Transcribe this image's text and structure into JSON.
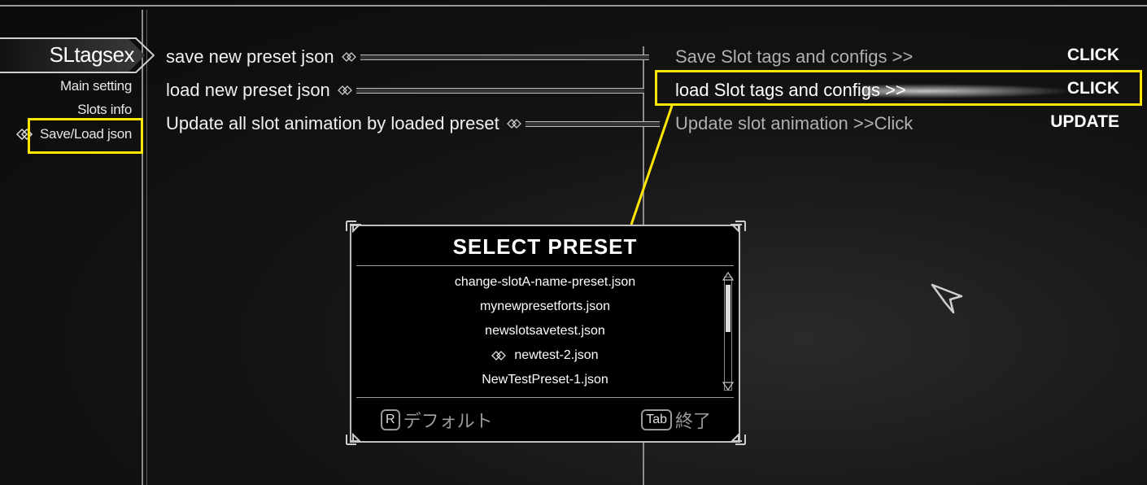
{
  "nav": {
    "title": "SLtagsex",
    "items": [
      {
        "label": "Main setting"
      },
      {
        "label": "Slots info"
      },
      {
        "label": "Save/Load json"
      }
    ]
  },
  "left_options": [
    {
      "label": "save new preset json"
    },
    {
      "label": "load new preset json"
    },
    {
      "label": "Update all slot animation by loaded preset"
    }
  ],
  "right_options": [
    {
      "label": "Save Slot tags and configs >>",
      "value": "CLICK"
    },
    {
      "label": "load Slot tags and configs >>",
      "value": "CLICK"
    },
    {
      "label": "Update slot animation >>Click",
      "value": "UPDATE"
    }
  ],
  "dialog": {
    "title": "SELECT PRESET",
    "items": [
      "change-slotA-name-preset.json",
      "mynewpresetforts.json",
      "newslotsavetest.json",
      "newtest-2.json",
      "NewTestPreset-1.json"
    ],
    "selected_index": 3,
    "footer_left_key": "R",
    "footer_left_label": "デフォルト",
    "footer_right_key": "Tab",
    "footer_right_label": "終了"
  },
  "colors": {
    "highlight": "#ffe600",
    "background": "#111111"
  }
}
